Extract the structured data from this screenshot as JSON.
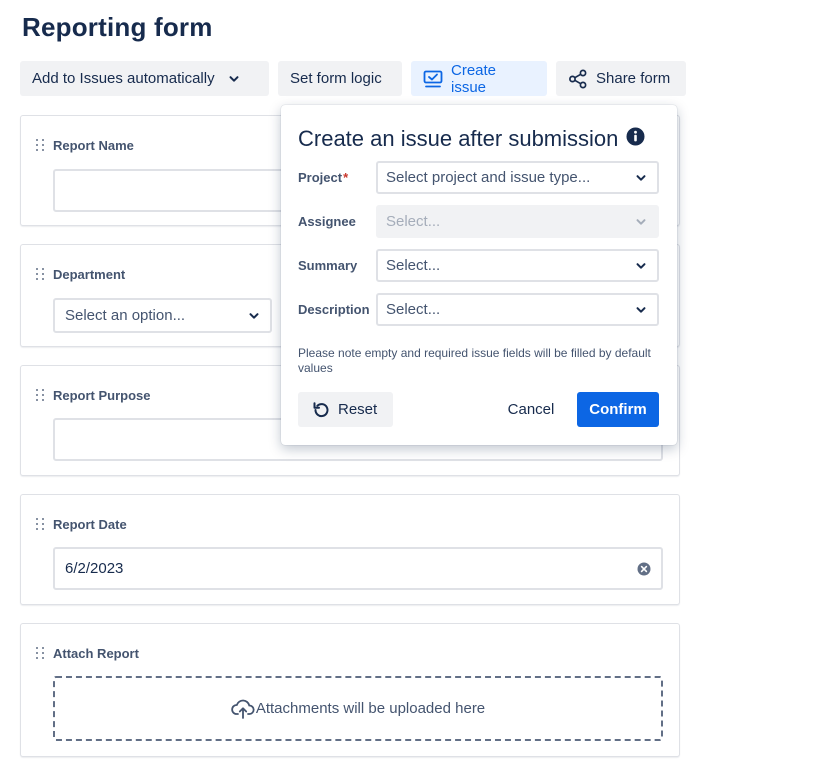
{
  "page": {
    "title": "Reporting form"
  },
  "toolbar": {
    "add_to_issues_label": "Add to Issues automatically",
    "set_form_logic_label": "Set form logic",
    "create_issue_label": "Create issue",
    "share_form_label": "Share form"
  },
  "form": {
    "report_name": {
      "label": "Report Name",
      "value": ""
    },
    "department": {
      "label": "Department",
      "placeholder": "Select an option..."
    },
    "report_purpose": {
      "label": "Report Purpose",
      "value": ""
    },
    "report_date": {
      "label": "Report Date",
      "value": "6/2/2023"
    },
    "attach_report": {
      "label": "Attach Report",
      "upload_text": "Attachments will be uploaded here"
    }
  },
  "popover": {
    "title": "Create an issue after submission",
    "fields": {
      "project": {
        "label": "Project",
        "required_mark": "*",
        "placeholder": "Select project and issue type..."
      },
      "assignee": {
        "label": "Assignee",
        "placeholder": "Select..."
      },
      "summary": {
        "label": "Summary",
        "placeholder": "Select..."
      },
      "description": {
        "label": "Description",
        "placeholder": "Select..."
      }
    },
    "note": "Please note empty and required issue fields will be filled by default values",
    "reset_label": "Reset",
    "cancel_label": "Cancel",
    "confirm_label": "Confirm"
  },
  "colors": {
    "accent": "#0c66e4",
    "accent_bg": "#e9f2ff",
    "button_bg": "#f1f2f4",
    "text": "#172b4d",
    "subtle_text": "#44546f",
    "required": "#c9372c"
  },
  "icons": {
    "toolbar_dropdown": "chevron-down-icon",
    "create_issue": "create-issue-icon",
    "share": "share-icon",
    "info": "info-icon",
    "reset": "undo-icon",
    "clear": "clear-icon",
    "upload": "cloud-upload-icon",
    "drag": "drag-handle-icon"
  }
}
